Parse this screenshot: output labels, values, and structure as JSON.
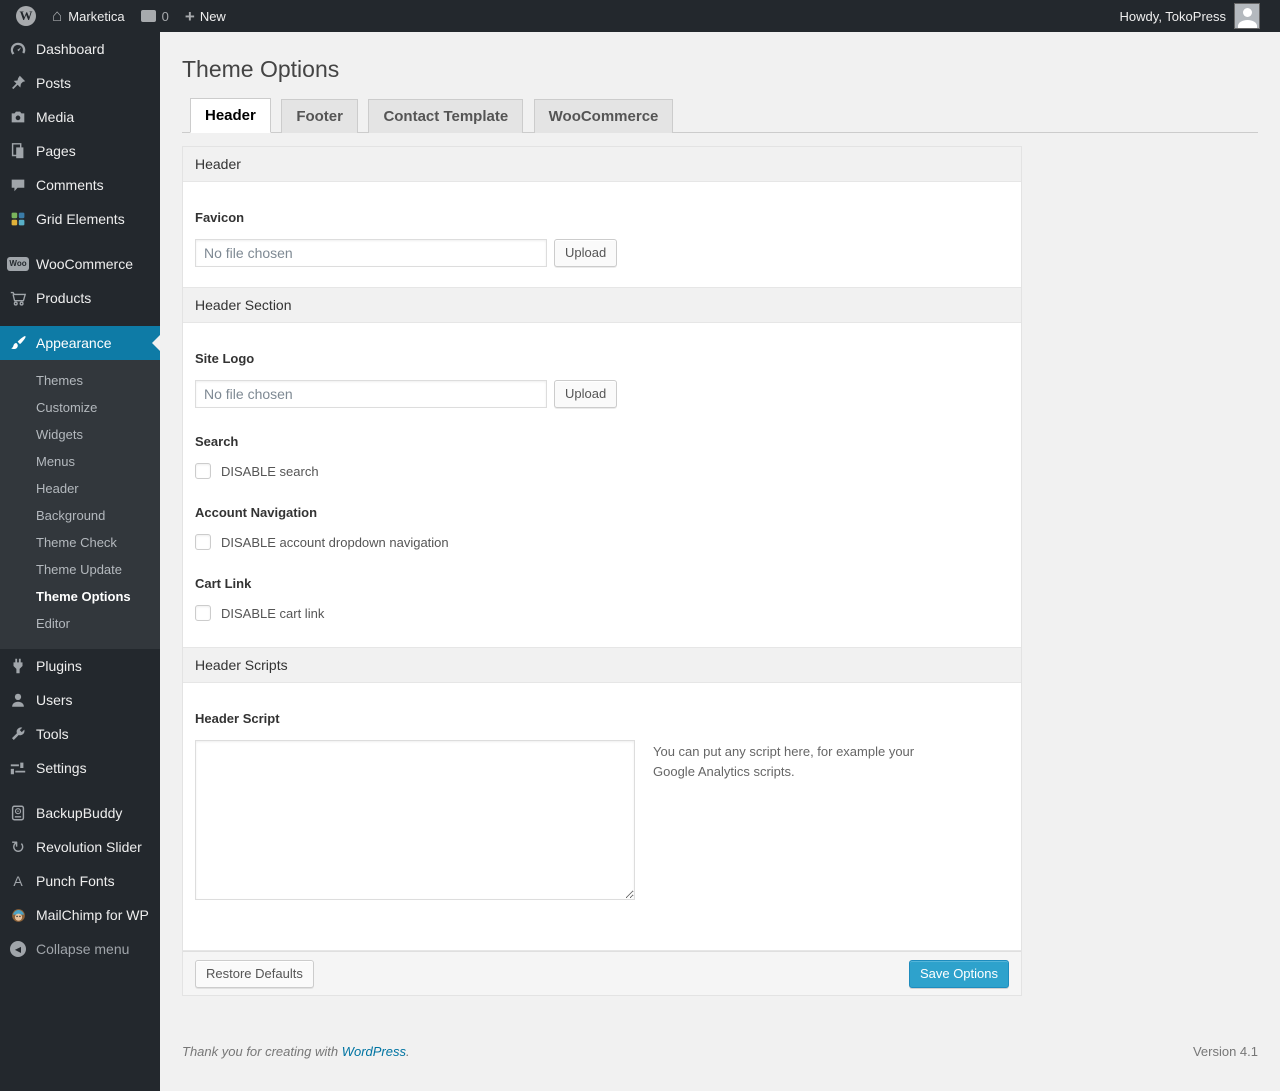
{
  "admin_bar": {
    "site_name": "Marketica",
    "comments_count": "0",
    "new_label": "New",
    "howdy": "Howdy, TokoPress"
  },
  "glyphs": {
    "wp_logo": "W",
    "home": "⌂",
    "plus": "+",
    "woo": "Woo",
    "punch": "A",
    "revslider": "↻",
    "collapse_arrow": "◀"
  },
  "sidebar": {
    "items": [
      {
        "label": "Dashboard"
      },
      {
        "label": "Posts"
      },
      {
        "label": "Media"
      },
      {
        "label": "Pages"
      },
      {
        "label": "Comments"
      },
      {
        "label": "Grid Elements"
      },
      {
        "label": "WooCommerce"
      },
      {
        "label": "Products"
      },
      {
        "label": "Appearance",
        "active": true
      },
      {
        "label": "Plugins"
      },
      {
        "label": "Users"
      },
      {
        "label": "Tools"
      },
      {
        "label": "Settings"
      },
      {
        "label": "BackupBuddy"
      },
      {
        "label": "Revolution Slider"
      },
      {
        "label": "Punch Fonts"
      },
      {
        "label": "MailChimp for WP"
      }
    ],
    "appearance_submenu": [
      {
        "label": "Themes"
      },
      {
        "label": "Customize"
      },
      {
        "label": "Widgets"
      },
      {
        "label": "Menus"
      },
      {
        "label": "Header"
      },
      {
        "label": "Background"
      },
      {
        "label": "Theme Check"
      },
      {
        "label": "Theme Update"
      },
      {
        "label": "Theme Options",
        "current": true
      },
      {
        "label": "Editor"
      }
    ],
    "collapse_label": "Collapse menu"
  },
  "page": {
    "title": "Theme Options",
    "tabs": [
      {
        "label": "Header",
        "active": true
      },
      {
        "label": "Footer",
        "active": false
      },
      {
        "label": "Contact Template",
        "active": false
      },
      {
        "label": "WooCommerce",
        "active": false
      }
    ]
  },
  "form": {
    "sections": [
      {
        "title": "Header",
        "fields": [
          {
            "label": "Favicon",
            "placeholder": "No file chosen",
            "button": "Upload",
            "value": ""
          }
        ]
      },
      {
        "title": "Header Section",
        "fields": [
          {
            "label": "Site Logo",
            "placeholder": "No file chosen",
            "button": "Upload",
            "value": ""
          },
          {
            "label": "Search",
            "checkbox": "DISABLE search",
            "checked": false
          },
          {
            "label": "Account Navigation",
            "checkbox": "DISABLE account dropdown navigation",
            "checked": false
          },
          {
            "label": "Cart Link",
            "checkbox": "DISABLE cart link",
            "checked": false
          }
        ]
      },
      {
        "title": "Header Scripts",
        "fields": [
          {
            "label": "Header Script",
            "value": "",
            "help": "You can put any script here, for example your Google Analytics scripts."
          }
        ]
      }
    ]
  },
  "footer_bar": {
    "restore": "Restore Defaults",
    "save": "Save Options"
  },
  "page_footer": {
    "thanks_prefix": "Thank you for creating with ",
    "link_text": "WordPress",
    "suffix": ".",
    "version": "Version 4.1"
  },
  "colors": {
    "accent": "#0e7ba6",
    "primary_button": "#2ea2cc",
    "admin_bar_bg": "#23282d",
    "sidebar_bg": "#23282d",
    "link": "#0074a2"
  }
}
